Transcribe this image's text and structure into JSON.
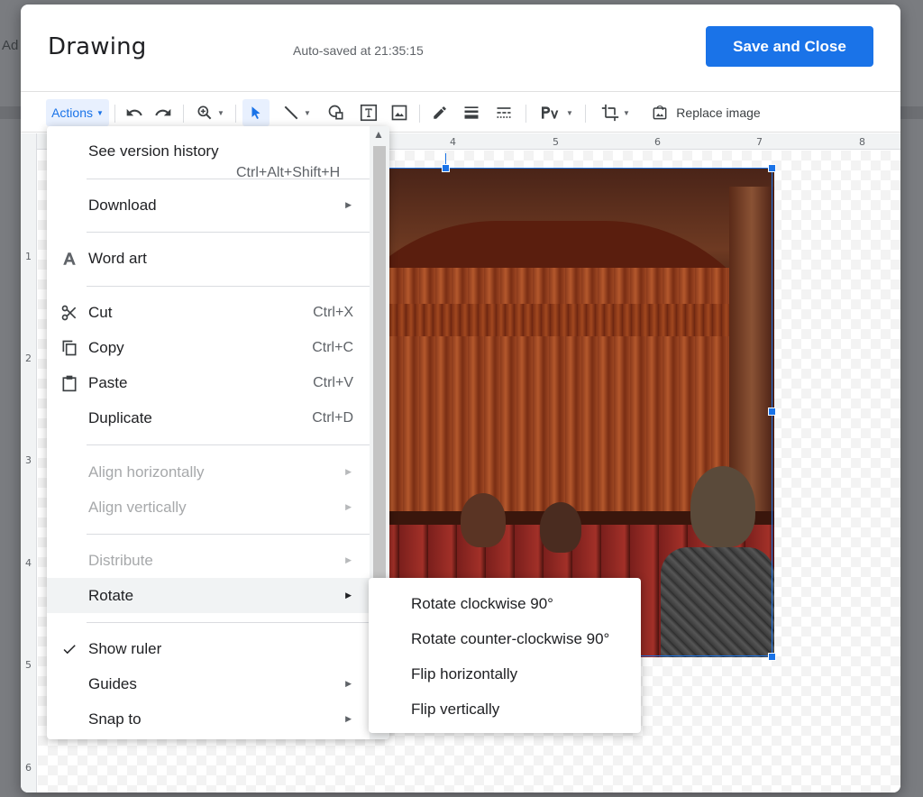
{
  "background": {
    "doc_text": "Ad"
  },
  "dialog": {
    "title": "Drawing",
    "autosave": "Auto-saved at 21:35:15",
    "save_label": "Save and Close"
  },
  "toolbar": {
    "actions_label": "Actions",
    "replace_image_label": "Replace image",
    "icons": [
      "undo-icon",
      "redo-icon",
      "zoom-icon",
      "select-icon",
      "line-icon",
      "shape-icon",
      "textbox-icon",
      "image-icon",
      "pen-icon",
      "line-weight-icon",
      "line-dash-icon",
      "font-icon",
      "crop-icon",
      "replace-image-icon"
    ]
  },
  "rulers": {
    "top": [
      "4",
      "5",
      "6",
      "7",
      "8"
    ],
    "left": [
      "1",
      "2",
      "3",
      "4",
      "5",
      "6"
    ]
  },
  "actions_menu": {
    "see_history": {
      "label": "See version history",
      "shortcut": "Ctrl+Alt+Shift+H"
    },
    "download": {
      "label": "Download"
    },
    "word_art": {
      "label": "Word art"
    },
    "cut": {
      "label": "Cut",
      "shortcut": "Ctrl+X"
    },
    "copy": {
      "label": "Copy",
      "shortcut": "Ctrl+C"
    },
    "paste": {
      "label": "Paste",
      "shortcut": "Ctrl+V"
    },
    "duplicate": {
      "label": "Duplicate",
      "shortcut": "Ctrl+D"
    },
    "align_h": {
      "label": "Align horizontally"
    },
    "align_v": {
      "label": "Align vertically"
    },
    "distribute": {
      "label": "Distribute"
    },
    "rotate": {
      "label": "Rotate"
    },
    "show_ruler": {
      "label": "Show ruler",
      "checked": true
    },
    "guides": {
      "label": "Guides"
    },
    "snap_to": {
      "label": "Snap to"
    }
  },
  "rotate_submenu": {
    "items": [
      "Rotate clockwise 90°",
      "Rotate counter-clockwise 90°",
      "Flip horizontally",
      "Flip vertically"
    ]
  },
  "colors": {
    "accent": "#1a73e8",
    "hover": "#f1f3f4",
    "disabled": "#a7a9ab"
  }
}
